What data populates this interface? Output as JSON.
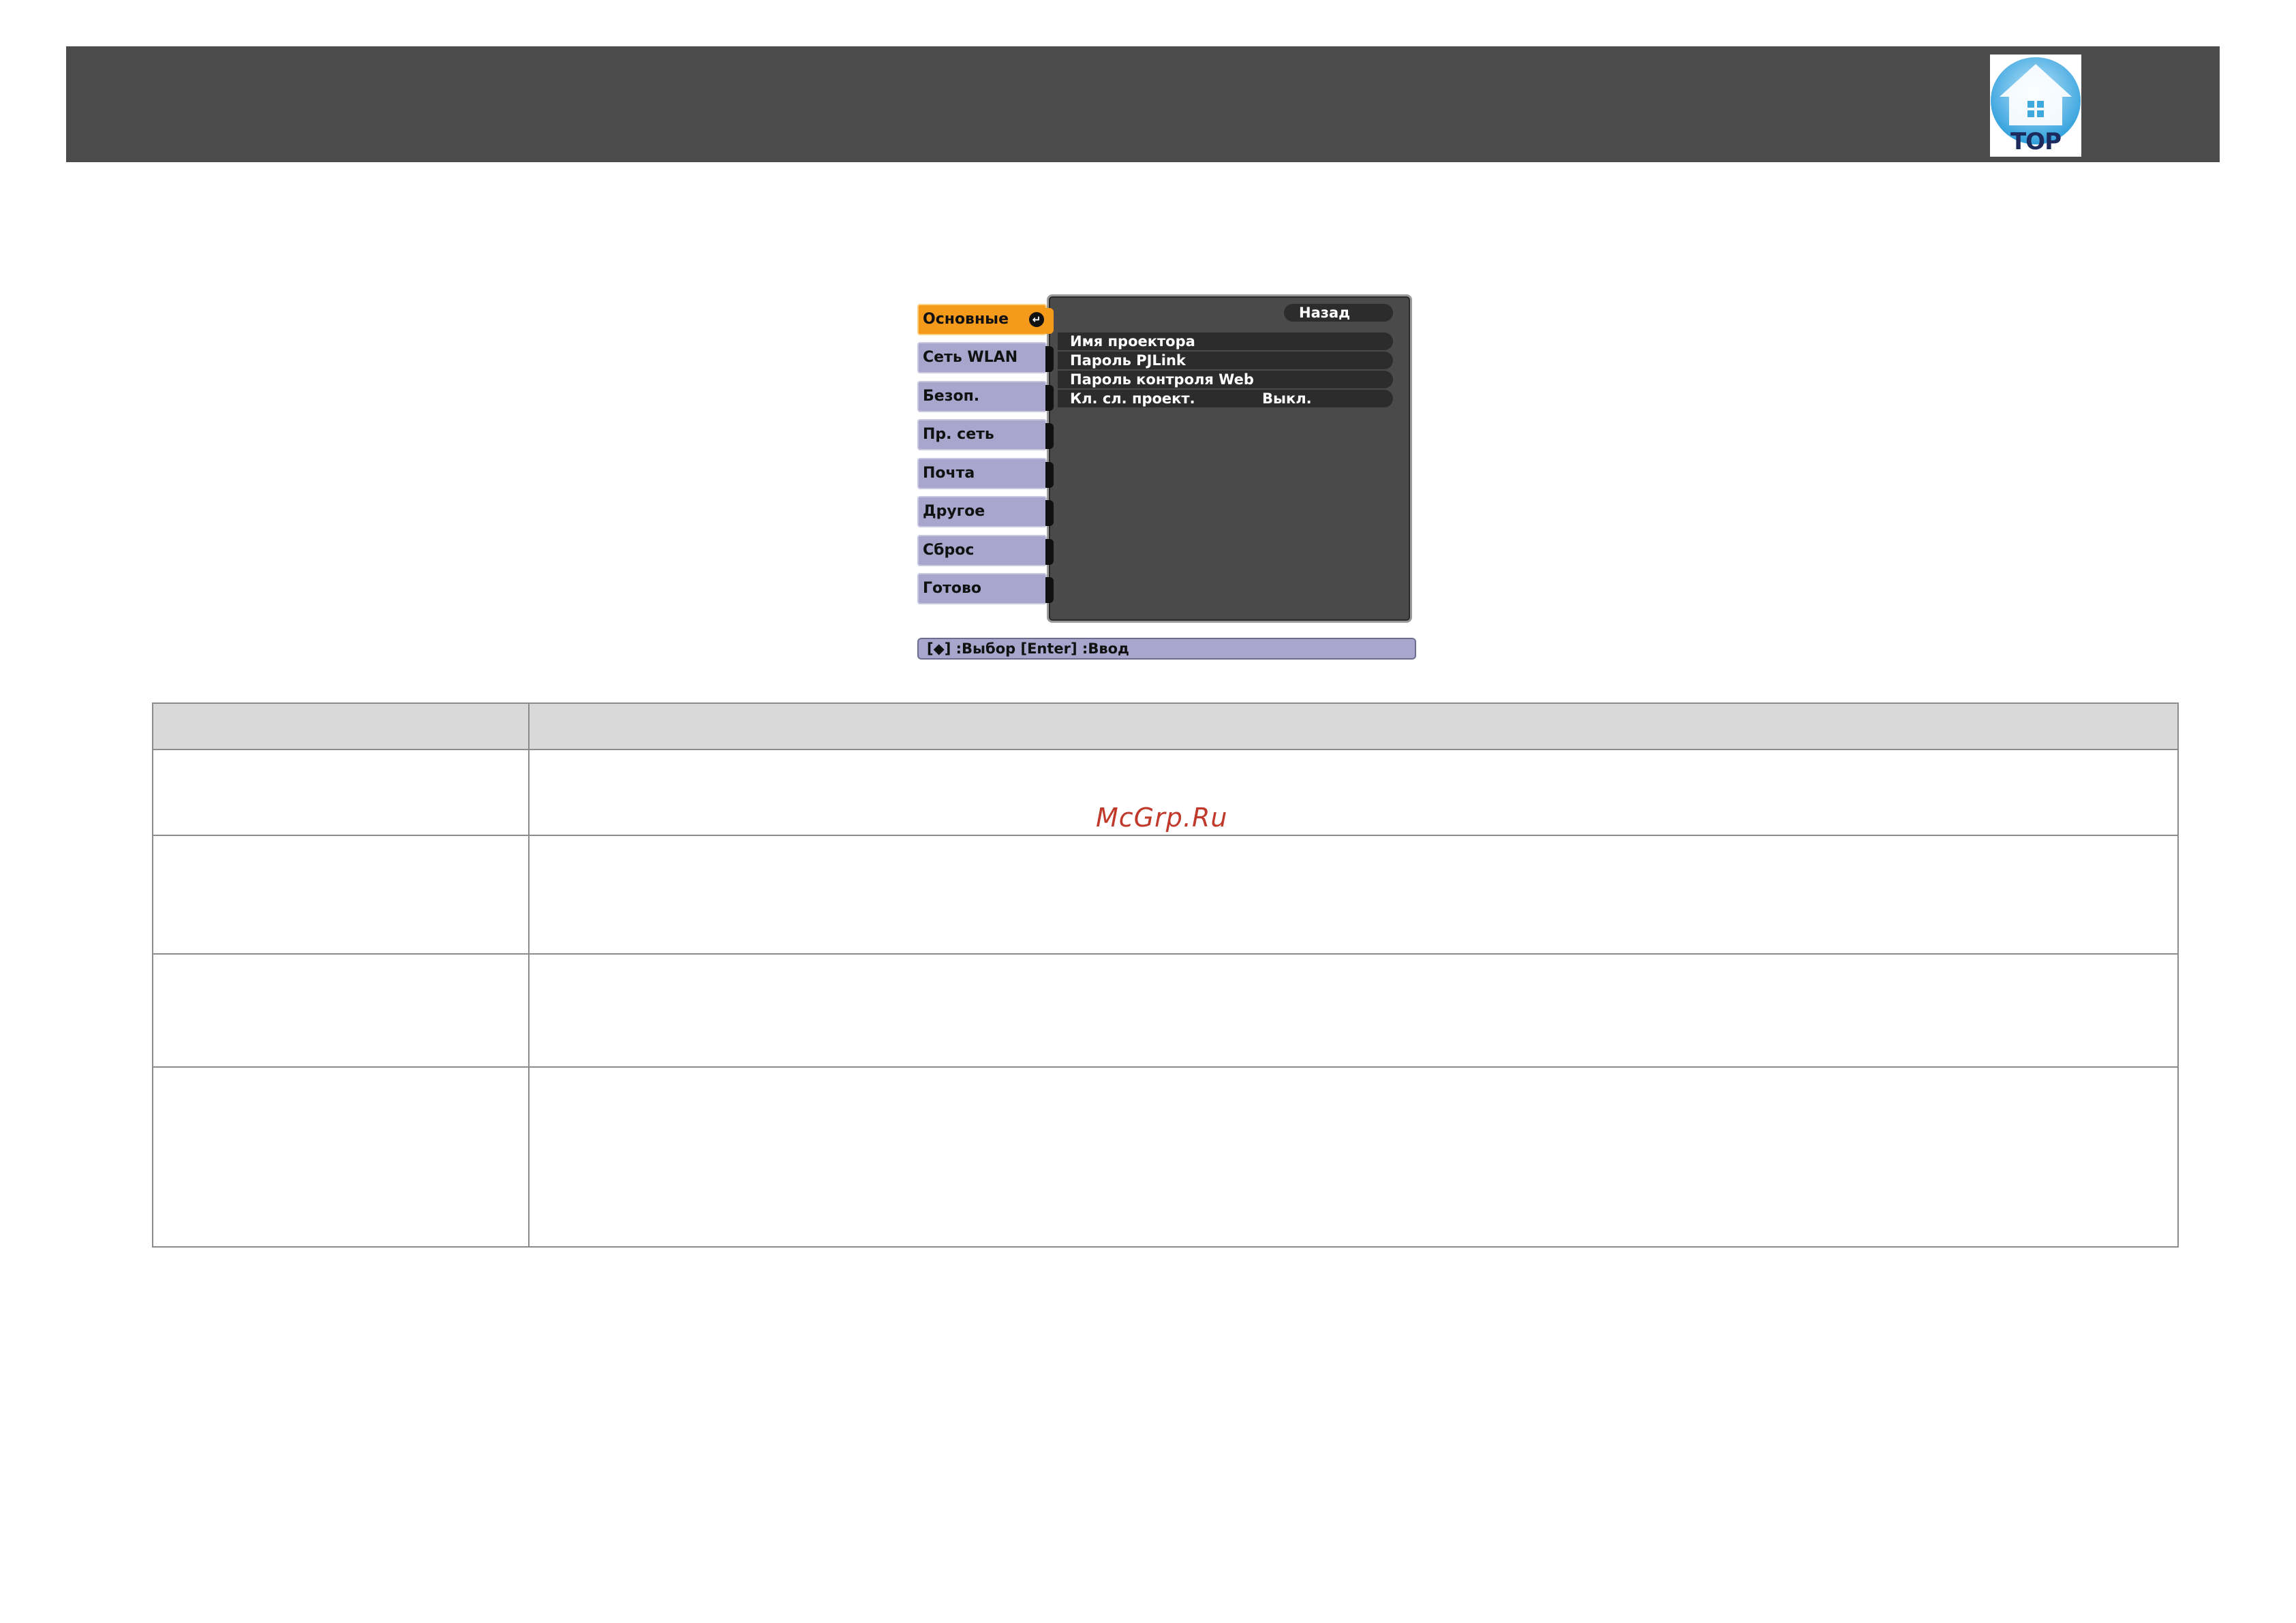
{
  "header": {
    "logo_label": "TOP"
  },
  "osd": {
    "tabs": [
      {
        "label": "Основные",
        "active": true
      },
      {
        "label": "Сеть WLAN",
        "active": false
      },
      {
        "label": "Безоп.",
        "active": false
      },
      {
        "label": "Пр. сеть",
        "active": false
      },
      {
        "label": "Почта",
        "active": false
      },
      {
        "label": "Другое",
        "active": false
      },
      {
        "label": "Сброс",
        "active": false
      },
      {
        "label": "Готово",
        "active": false
      }
    ],
    "back_label": "Назад",
    "items": [
      {
        "label": "Имя проектора",
        "value": ""
      },
      {
        "label": "Пароль PJLink",
        "value": ""
      },
      {
        "label": "Пароль контроля Web",
        "value": ""
      },
      {
        "label": "Кл. сл. проект.",
        "value": "Выкл."
      }
    ],
    "status_bar": "[◆] :Выбор  [Enter] :Ввод"
  },
  "table": {
    "rows": [
      {
        "cells": [
          "",
          ""
        ]
      },
      {
        "cells": [
          "",
          ""
        ]
      },
      {
        "cells": [
          "",
          ""
        ]
      },
      {
        "cells": [
          "",
          ""
        ]
      }
    ]
  },
  "watermark": "McGrp.Ru",
  "colors": {
    "header_bar": "#4b4b4b",
    "tab_active": "#f59a1a",
    "tab_inactive": "#a8a6cc",
    "osd_panel": "#4a4a4a",
    "logo_blue": "#3fa9df",
    "watermark": "#c0392b"
  }
}
